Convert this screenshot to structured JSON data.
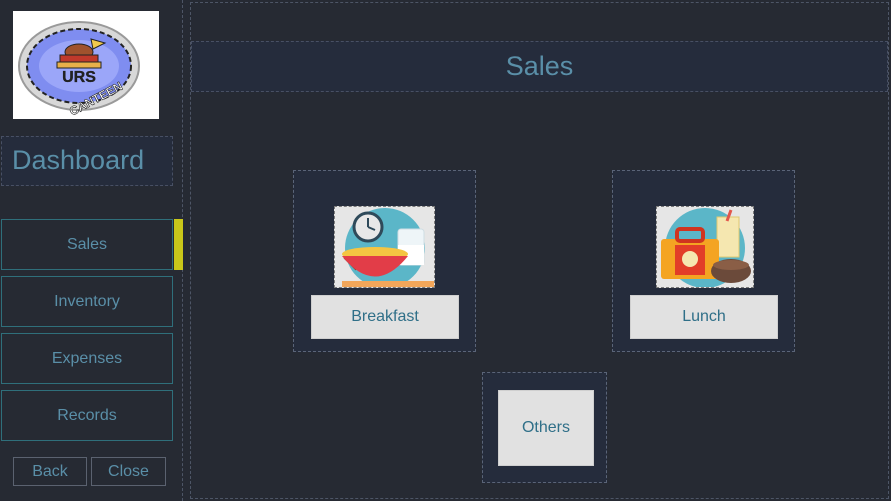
{
  "sidebar": {
    "logo_text_top": "URS",
    "logo_text_bottom": "CANTEEN",
    "title": "Dashboard",
    "items": [
      {
        "label": "Sales"
      },
      {
        "label": "Inventory"
      },
      {
        "label": "Expenses"
      },
      {
        "label": "Records"
      }
    ],
    "back_label": "Back",
    "close_label": "Close"
  },
  "main": {
    "title": "Sales",
    "cards": [
      {
        "label": "Breakfast",
        "icon": "breakfast-icon"
      },
      {
        "label": "Lunch",
        "icon": "lunch-icon"
      },
      {
        "label": "Others"
      }
    ]
  },
  "colors": {
    "background": "#262a33",
    "panel": "#252c3c",
    "text_accent": "#5a8fa8",
    "active_indicator": "#c9c71a",
    "button_fill": "#e1e1e1"
  }
}
